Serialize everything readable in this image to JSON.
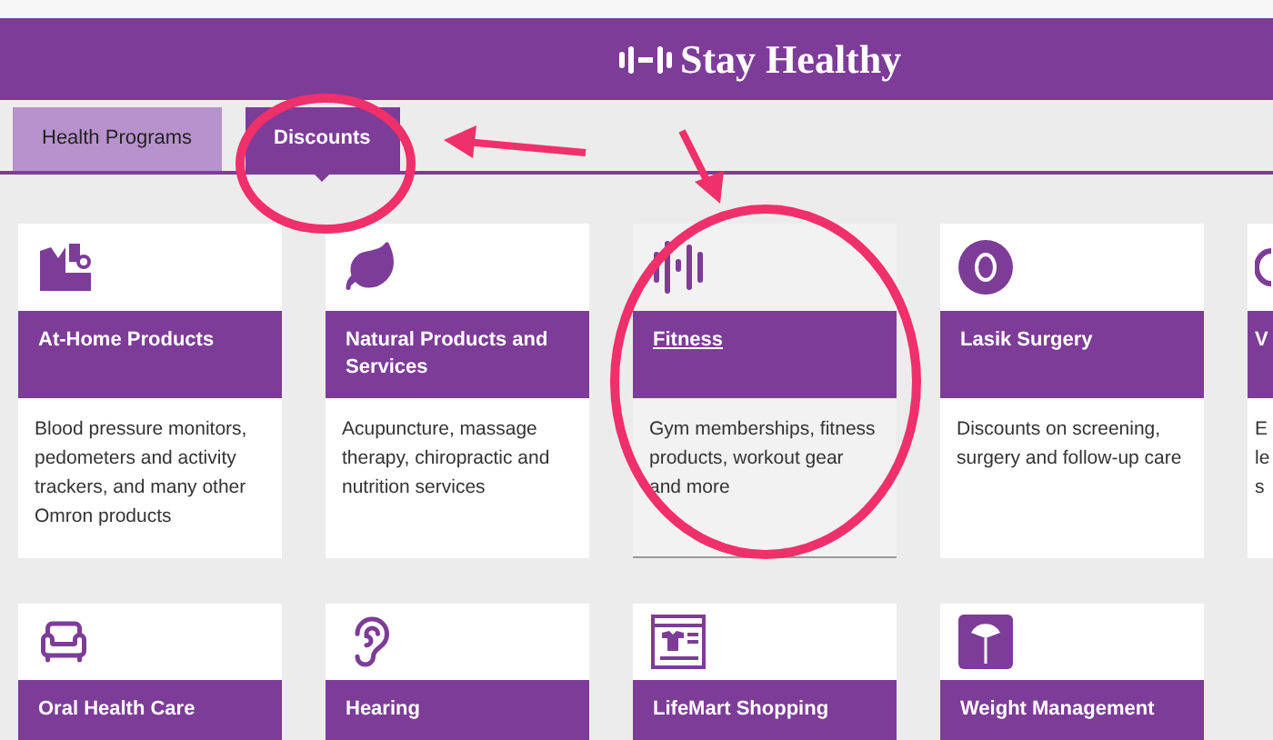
{
  "header": {
    "logo_text": "Stay Healthy"
  },
  "tabs": [
    {
      "label": "Health Programs",
      "selected": false
    },
    {
      "label": "Discounts",
      "selected": true
    }
  ],
  "rows": [
    [
      {
        "kind": "devices",
        "title": "At-Home Products",
        "description": "Blood pressure monitors, pedometers and activity trackers, and many other Omron products",
        "hovered": false
      },
      {
        "kind": "mortar",
        "title": "Natural Products and Services",
        "description": "Acupuncture, massage therapy, chiropractic and nutrition services",
        "hovered": false
      },
      {
        "kind": "bars",
        "title": "Fitness",
        "description": "Gym memberships, fitness products, workout gear and more",
        "hovered": true
      },
      {
        "kind": "eye",
        "title": "Lasik Surgery",
        "description": "Discounts on screening, surgery and follow-up care",
        "hovered": false
      },
      {
        "kind": "partial",
        "title": "V",
        "description_lines": [
          "E",
          "le",
          "s"
        ],
        "hovered": false
      }
    ],
    [
      {
        "kind": "chair",
        "title": "Oral Health Care",
        "hovered": false
      },
      {
        "kind": "ear",
        "title": "Hearing",
        "hovered": false
      },
      {
        "kind": "window",
        "title": "LifeMart Shopping",
        "hovered": false
      },
      {
        "kind": "scale",
        "title": "Weight Management",
        "hovered": false
      }
    ]
  ]
}
